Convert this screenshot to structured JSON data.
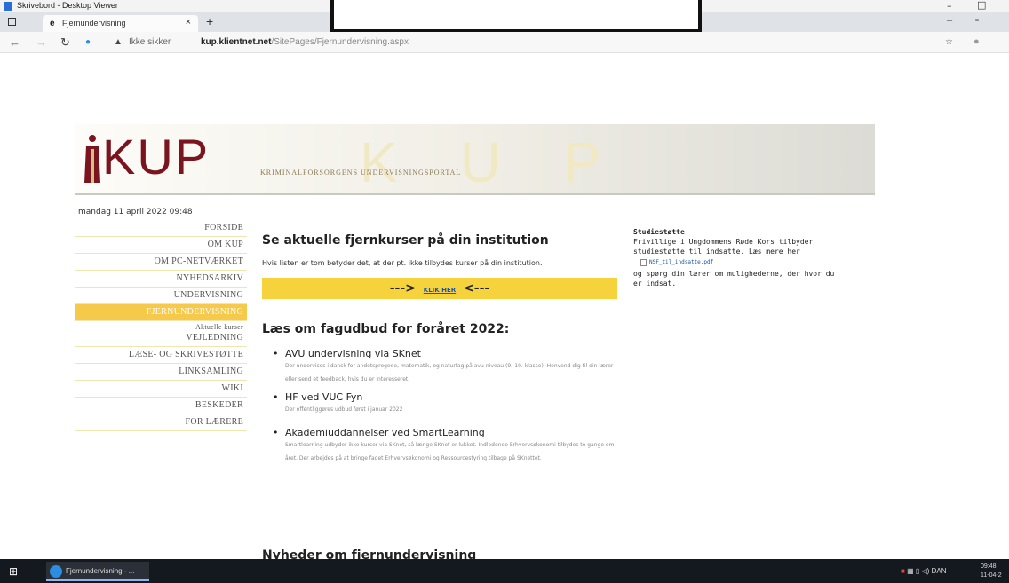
{
  "outer_window": {
    "title": "Skrivebord - Desktop Viewer",
    "min": "–",
    "max": "□"
  },
  "browser": {
    "tab_title": "Fjernundervisning",
    "tab_close": "×",
    "new_tab": "+",
    "remote_label": "...... ▾ ......",
    "security": "Ikke sikker",
    "url_host": "kup.klientnet.net",
    "url_path": "/SitePages/Fjernundervisning.aspx"
  },
  "site": {
    "logo": "KUP",
    "ghost_letters": "KUP",
    "tagline": "KRIMINALFORSORGENS UNDERVISNINGSPORTAL",
    "datestamp": "mandag 11 april 2022 09:48"
  },
  "nav": {
    "forside": "FORSIDE",
    "om_kup": "OM KUP",
    "om_pc": "OM PC-NETVÆRKET",
    "nyhedsarkiv": "NYHEDSARKIV",
    "undervisning": "UNDERVISNING",
    "fjernundervisning": "FJERNUNDERVISNING",
    "aktuelle": "Aktuelle kurser",
    "vejledning": "VEJLEDNING",
    "laese": "LÆSE- OG SKRIVESTØTTE",
    "linksamling": "LINKSAMLING",
    "wiki": "WIKI",
    "beskeder": "BESKEDER",
    "for_laerere": "FOR LÆRERE"
  },
  "main": {
    "heading": "Se aktuelle fjernkurser på din institution",
    "note": "Hvis listen er tom betyder det, at der pt. ikke tilbydes kurser på din institution.",
    "klik_left": "--->",
    "klik_link": "KLIK HER",
    "klik_right": "<---",
    "fagudbud": "Læs om fagudbud for foråret 2022:",
    "courses": [
      {
        "title": "AVU undervisning via SKnet",
        "desc": "Der undervises i dansk for andetsprogede, matematik, og naturfag på avu-niveau (9.-10. klasse). Henvend dig til din lærer eller send et feedback, hvis du er interesseret."
      },
      {
        "title": "HF ved VUC Fyn",
        "desc": "Der offentliggøres udbud først i januar 2022"
      },
      {
        "title": "Akademiuddannelser ved SmartLearning",
        "desc": "Smartlearning udbyder ikke kurser via SKnet, så længe SKnet er lukket. Indledende Erhvervsøkonomi tilbydes to gange om året. Der arbejdes på at bringe faget Erhvervsøkonomi og Ressourcestyring tilbage på SKnettet."
      }
    ],
    "nyheder": "Nyheder om fjernundervisning"
  },
  "sidebar": {
    "heading": "Studiestøtte",
    "text1": "Frivillige i Ungdommens Røde Kors tilbyder studiestøtte til indsatte. Læs mere her",
    "file": "NSF_til_indsatte.pdf",
    "text2": "og spørg din lærer om mulighederne, der hvor du er indsat."
  },
  "taskbar": {
    "app": "Fjernundervisning - ...",
    "lang": "DAN",
    "time": "09:48",
    "date": "11-04-2"
  }
}
